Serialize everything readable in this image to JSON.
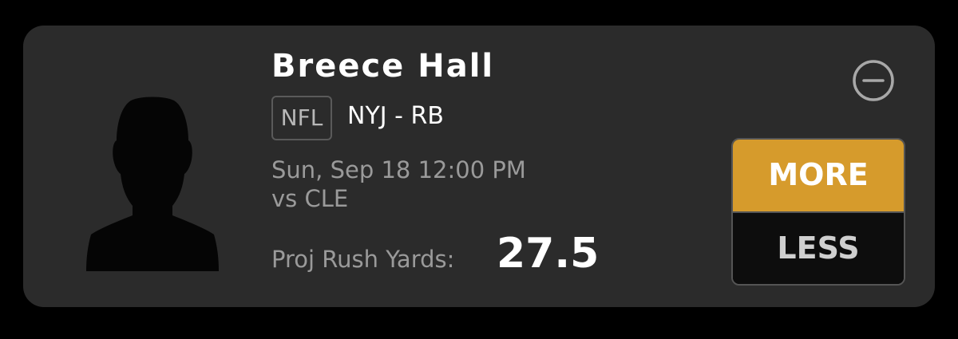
{
  "player": {
    "name": "Breece Hall",
    "league": "NFL",
    "team_position": "NYJ - RB",
    "game_time": "Sun, Sep 18 12:00 PM",
    "opponent": "vs CLE"
  },
  "projection": {
    "label": "Proj Rush Yards:",
    "value": "27.5"
  },
  "actions": {
    "more_label": "MORE",
    "less_label": "LESS",
    "remove_icon": "minus-circle-icon"
  },
  "colors": {
    "background": "#000000",
    "card": "#2b2b2b",
    "more_accent": "#d69b2c",
    "less_background": "#0d0d0d"
  }
}
